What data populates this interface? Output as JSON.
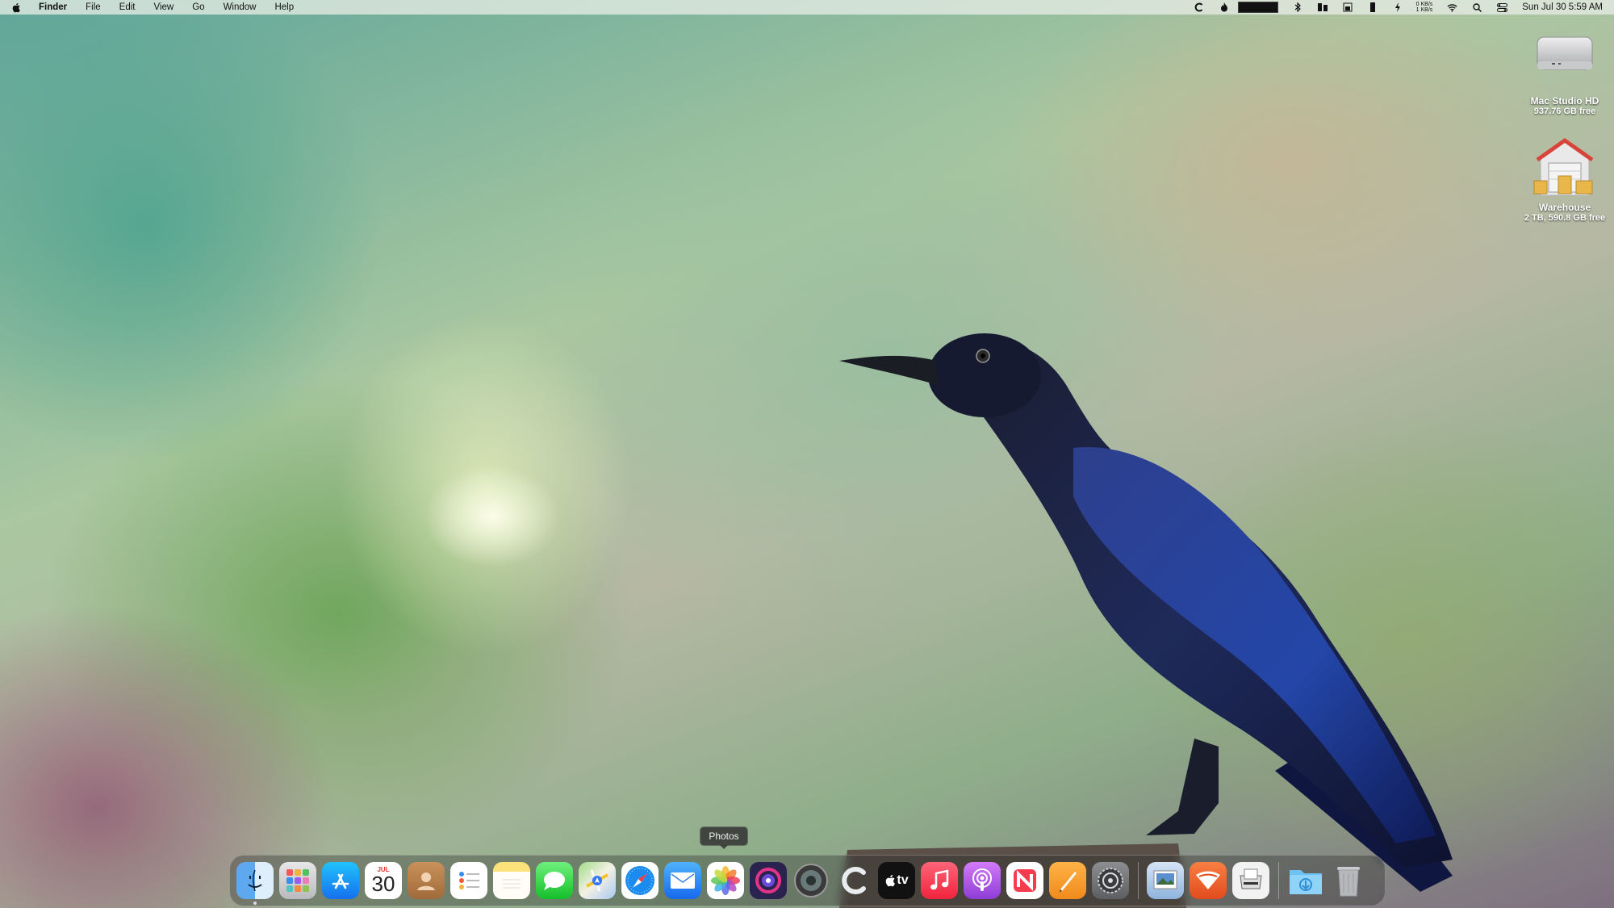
{
  "menubar": {
    "app_name": "Finder",
    "menus": [
      "File",
      "Edit",
      "View",
      "Go",
      "Window",
      "Help"
    ],
    "status_icons": [
      "c-icon",
      "flame-icon",
      "battery-meter-icon",
      "bluetooth-icon",
      "memory-icon",
      "disk-icon",
      "cpu-icon",
      "energy-icon",
      "wifi-icon",
      "search-icon",
      "control-center-icon"
    ],
    "network_up": "0 KB/s",
    "network_down": "1 KB/s",
    "clock": "Sun Jul 30  5:59 AM"
  },
  "desktop": {
    "items": [
      {
        "name": "Mac Studio HD",
        "detail": "937.76 GB free",
        "icon": "mac-studio-drive-icon"
      },
      {
        "name": "Warehouse",
        "detail": "2 TB, 590.8 GB free",
        "icon": "warehouse-drive-icon"
      }
    ]
  },
  "tooltip": {
    "text": "Photos"
  },
  "dock": {
    "calendar_month": "JUL",
    "calendar_day": "30",
    "tv_label": "tv",
    "apps": [
      "Finder",
      "Launchpad",
      "App Store",
      "Calendar",
      "Contacts",
      "Reminders",
      "Notes",
      "Messages",
      "Maps",
      "Safari",
      "Mail",
      "Photos",
      "Omnifocus",
      "Compressor",
      "CleanMyMac",
      "Apple TV",
      "Music",
      "Podcasts",
      "News",
      "Pages",
      "System Settings",
      "Preview",
      "Drafts",
      "Scanner",
      "Downloads",
      "Trash"
    ]
  },
  "colors": {
    "menubar_bg": "#e6ece4",
    "dock_bg": "#282828",
    "tooltip_bg": "#323232"
  }
}
